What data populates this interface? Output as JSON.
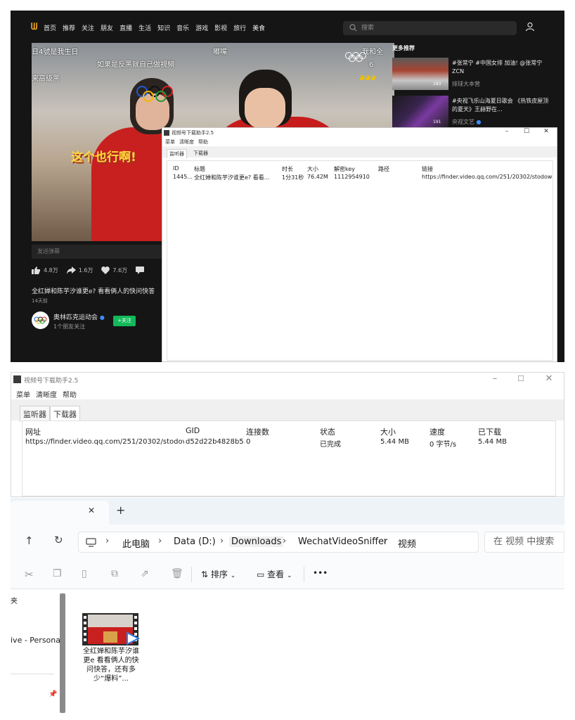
{
  "site": {
    "nav": [
      "首页",
      "推荐",
      "关注",
      "朋友",
      "直播",
      "生活",
      "知识",
      "音乐",
      "游戏",
      "影视",
      "旅行",
      "美食"
    ],
    "search_placeholder": "搜索",
    "subtitles": {
      "top_left": "日4號是我生日",
      "top_center": "嘟嘴",
      "top_right": "我和全",
      "mid_left": "如果是反黑就自己做視頻",
      "left": "来高级黑",
      "big": "这个也行啊!",
      "corner_num": "6"
    },
    "danmaku_placeholder": "发送弹幕",
    "stats": {
      "likes": "4.8万",
      "shares": "1.6万",
      "favorites": "7.6万"
    },
    "video_title": "全红婵和陈芋汐谁更e? 看看俩人的快问快答",
    "video_date": "14天前",
    "channel_name": "奥林匹克运动会",
    "channel_follow": "1个朋友关注",
    "follow_button": "+关注",
    "more_title": "更多推荐",
    "recommendations": [
      {
        "title": "#张常宁 #中国女排 加油! @张常宁ZCN",
        "source": "排球大本营",
        "count": "183"
      },
      {
        "title": "#央视飞乐山海夏日歌会 《热铁皮屋顶的夏天》王赫野在...",
        "source": "央视文艺",
        "count": "191"
      }
    ]
  },
  "win1": {
    "title": "视频号下载助手2.5",
    "menu": [
      "菜单",
      "清晰度",
      "帮助"
    ],
    "tabs": [
      "监听器",
      "下载器"
    ],
    "columns": [
      "ID",
      "标题",
      "时长",
      "大小",
      "解密key",
      "路径",
      "链接"
    ],
    "row": {
      "id": "1445...",
      "title": "全红婵和陈芋汐谁更e? 看看...",
      "duration": "1分31秒",
      "size": "76.42M",
      "key": "1112954910",
      "path": "",
      "link": "https://finder.video.qq.com/251/20302/stodown..."
    },
    "controls": [
      "–",
      "☐",
      "✕"
    ]
  },
  "win2": {
    "title": "视频号下载助手2.5",
    "menu": [
      "菜单",
      "清晰度",
      "帮助"
    ],
    "tabs": [
      "监听器",
      "下载器"
    ],
    "columns": [
      "网址",
      "GID",
      "连接数",
      "状态",
      "大小",
      "速度",
      "已下载"
    ],
    "row": {
      "url": "https://finder.video.qq.com/251/20302/stodow...",
      "gid": "d52d22b4828b5...",
      "connections": "0",
      "status": "已完成",
      "size": "5.44 MB",
      "speed": "0 字节/s",
      "downloaded": "5.44 MB"
    },
    "controls": [
      "–",
      "☐",
      "✕"
    ]
  },
  "explorer": {
    "tab_close": "✕",
    "tab_add": "+",
    "breadcrumbs": [
      "此电脑",
      "Data (D:)",
      "Downloads",
      "WechatVideoSniffer",
      "视频"
    ],
    "search_placeholder": "在 视频 中搜索",
    "sort_label": "排序",
    "view_label": "查看",
    "more_label": "•••",
    "sidebar": [
      "夹",
      "ive - Personal"
    ],
    "file_name": "全红婵和陈芋汐谁更e 看看俩人的快问快答，还有多少“爆料”..."
  },
  "colors": {
    "accent_green": "#12b859",
    "logo_orange": "#f5a623",
    "dark_bg": "#151515"
  }
}
